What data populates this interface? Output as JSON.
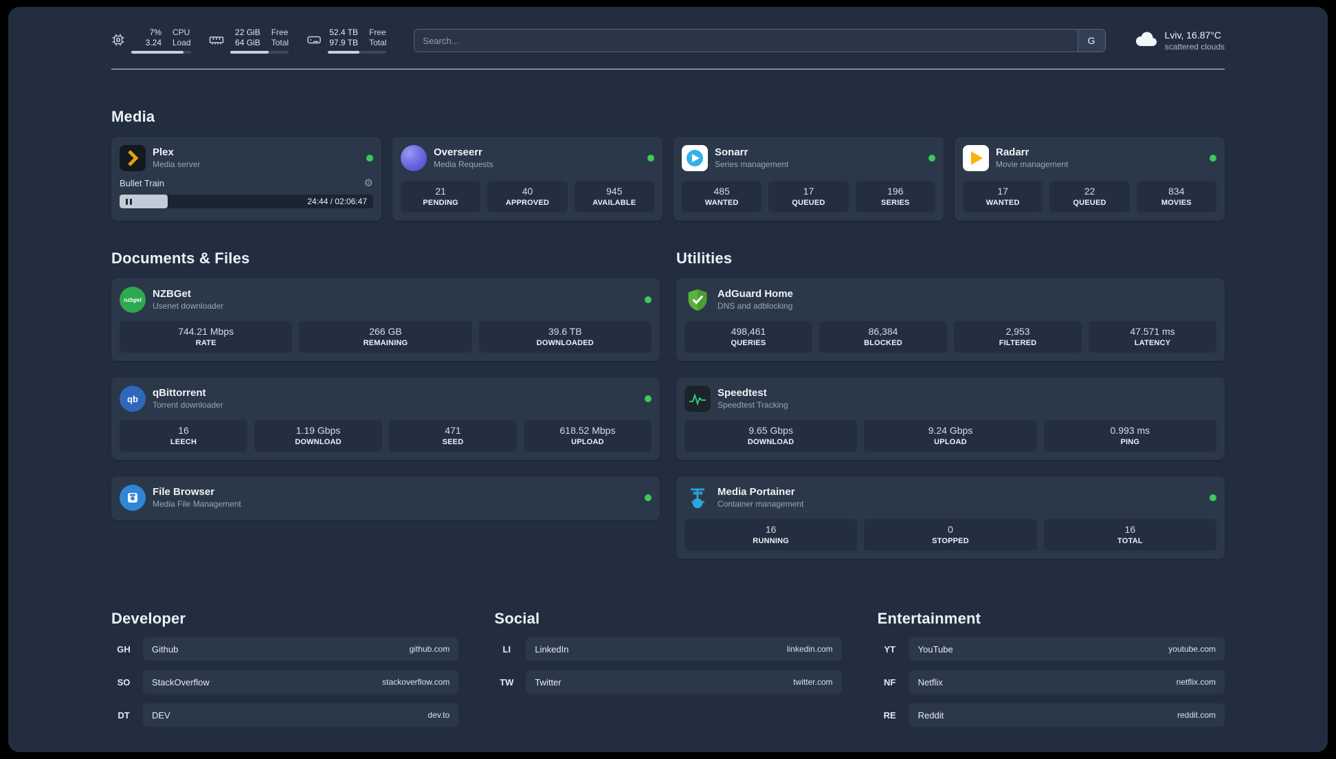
{
  "colors": {
    "background": "#222e40",
    "card": "#2b3849",
    "tile": "#232f41",
    "status_green": "#3ec95c",
    "plex_orange": "#e5a00d"
  },
  "topbar": {
    "cpu": {
      "icon": "cpu-icon",
      "value_top": "7%",
      "label_top": "CPU",
      "value_bottom": "3.24",
      "label_bottom": "Load"
    },
    "ram": {
      "icon": "ram-icon",
      "value_top": "22 GiB",
      "label_top": "Free",
      "value_bottom": "64 GiB",
      "label_bottom": "Total"
    },
    "disk": {
      "icon": "disk-icon",
      "value_top": "52.4 TB",
      "label_top": "Free",
      "value_bottom": "97.9 TB",
      "label_bottom": "Total"
    },
    "search": {
      "placeholder": "Search...",
      "button": "G"
    },
    "weather": {
      "icon": "cloud-icon",
      "location": "Lviv, 16.87°C",
      "condition": "scattered clouds"
    }
  },
  "sections": {
    "media": {
      "title": "Media",
      "apps": [
        {
          "name": "Plex",
          "subtitle": "Media server",
          "icon": "plex-icon",
          "status": "online",
          "player": {
            "track": "Bullet Train",
            "time": "24:44 / 02:06:47"
          }
        },
        {
          "name": "Overseerr",
          "subtitle": "Media Requests",
          "icon": "overseerr-icon",
          "status": "online",
          "stats": [
            {
              "value": "21",
              "label": "PENDING"
            },
            {
              "value": "40",
              "label": "APPROVED"
            },
            {
              "value": "945",
              "label": "AVAILABLE"
            }
          ]
        },
        {
          "name": "Sonarr",
          "subtitle": "Series management",
          "icon": "sonarr-icon",
          "status": "online",
          "stats": [
            {
              "value": "485",
              "label": "WANTED"
            },
            {
              "value": "17",
              "label": "QUEUED"
            },
            {
              "value": "196",
              "label": "SERIES"
            }
          ]
        },
        {
          "name": "Radarr",
          "subtitle": "Movie management",
          "icon": "radarr-icon",
          "status": "online",
          "stats": [
            {
              "value": "17",
              "label": "WANTED"
            },
            {
              "value": "22",
              "label": "QUEUED"
            },
            {
              "value": "834",
              "label": "MOVIES"
            }
          ]
        }
      ]
    },
    "documents": {
      "title": "Documents & Files",
      "apps": [
        {
          "name": "NZBGet",
          "subtitle": "Usenet downloader",
          "icon": "nzbget-icon",
          "status": "online",
          "stats": [
            {
              "value": "744.21 Mbps",
              "label": "RATE"
            },
            {
              "value": "266 GB",
              "label": "REMAINING"
            },
            {
              "value": "39.6 TB",
              "label": "DOWNLOADED"
            }
          ]
        },
        {
          "name": "qBittorrent",
          "subtitle": "Torrent downloader",
          "icon": "qbittorrent-icon",
          "status": "online",
          "stats": [
            {
              "value": "16",
              "label": "LEECH"
            },
            {
              "value": "1.19 Gbps",
              "label": "DOWNLOAD"
            },
            {
              "value": "471",
              "label": "SEED"
            },
            {
              "value": "618.52 Mbps",
              "label": "UPLOAD"
            }
          ]
        },
        {
          "name": "File Browser",
          "subtitle": "Media File Management",
          "icon": "filebrowser-icon",
          "status": "online"
        }
      ]
    },
    "utilities": {
      "title": "Utilities",
      "apps": [
        {
          "name": "AdGuard Home",
          "subtitle": "DNS and adblocking",
          "icon": "adguard-icon",
          "stats": [
            {
              "value": "498,461",
              "label": "QUERIES"
            },
            {
              "value": "86,384",
              "label": "BLOCKED"
            },
            {
              "value": "2,953",
              "label": "FILTERED"
            },
            {
              "value": "47.571 ms",
              "label": "LATENCY"
            }
          ]
        },
        {
          "name": "Speedtest",
          "subtitle": "Speedtest Tracking",
          "icon": "speedtest-icon",
          "stats": [
            {
              "value": "9.65 Gbps",
              "label": "DOWNLOAD"
            },
            {
              "value": "9.24 Gbps",
              "label": "UPLOAD"
            },
            {
              "value": "0.993 ms",
              "label": "PING"
            }
          ]
        },
        {
          "name": "Media Portainer",
          "subtitle": "Container management",
          "icon": "portainer-icon",
          "status": "online",
          "stats": [
            {
              "value": "16",
              "label": "RUNNING"
            },
            {
              "value": "0",
              "label": "STOPPED"
            },
            {
              "value": "16",
              "label": "TOTAL"
            }
          ]
        }
      ]
    },
    "developer": {
      "title": "Developer",
      "bookmarks": [
        {
          "abbr": "GH",
          "name": "Github",
          "url": "github.com"
        },
        {
          "abbr": "SO",
          "name": "StackOverflow",
          "url": "stackoverflow.com"
        },
        {
          "abbr": "DT",
          "name": "DEV",
          "url": "dev.to"
        }
      ]
    },
    "social": {
      "title": "Social",
      "bookmarks": [
        {
          "abbr": "LI",
          "name": "LinkedIn",
          "url": "linkedin.com"
        },
        {
          "abbr": "TW",
          "name": "Twitter",
          "url": "twitter.com"
        }
      ]
    },
    "entertainment": {
      "title": "Entertainment",
      "bookmarks": [
        {
          "abbr": "YT",
          "name": "YouTube",
          "url": "youtube.com"
        },
        {
          "abbr": "NF",
          "name": "Netflix",
          "url": "netflix.com"
        },
        {
          "abbr": "RE",
          "name": "Reddit",
          "url": "reddit.com"
        }
      ]
    }
  }
}
